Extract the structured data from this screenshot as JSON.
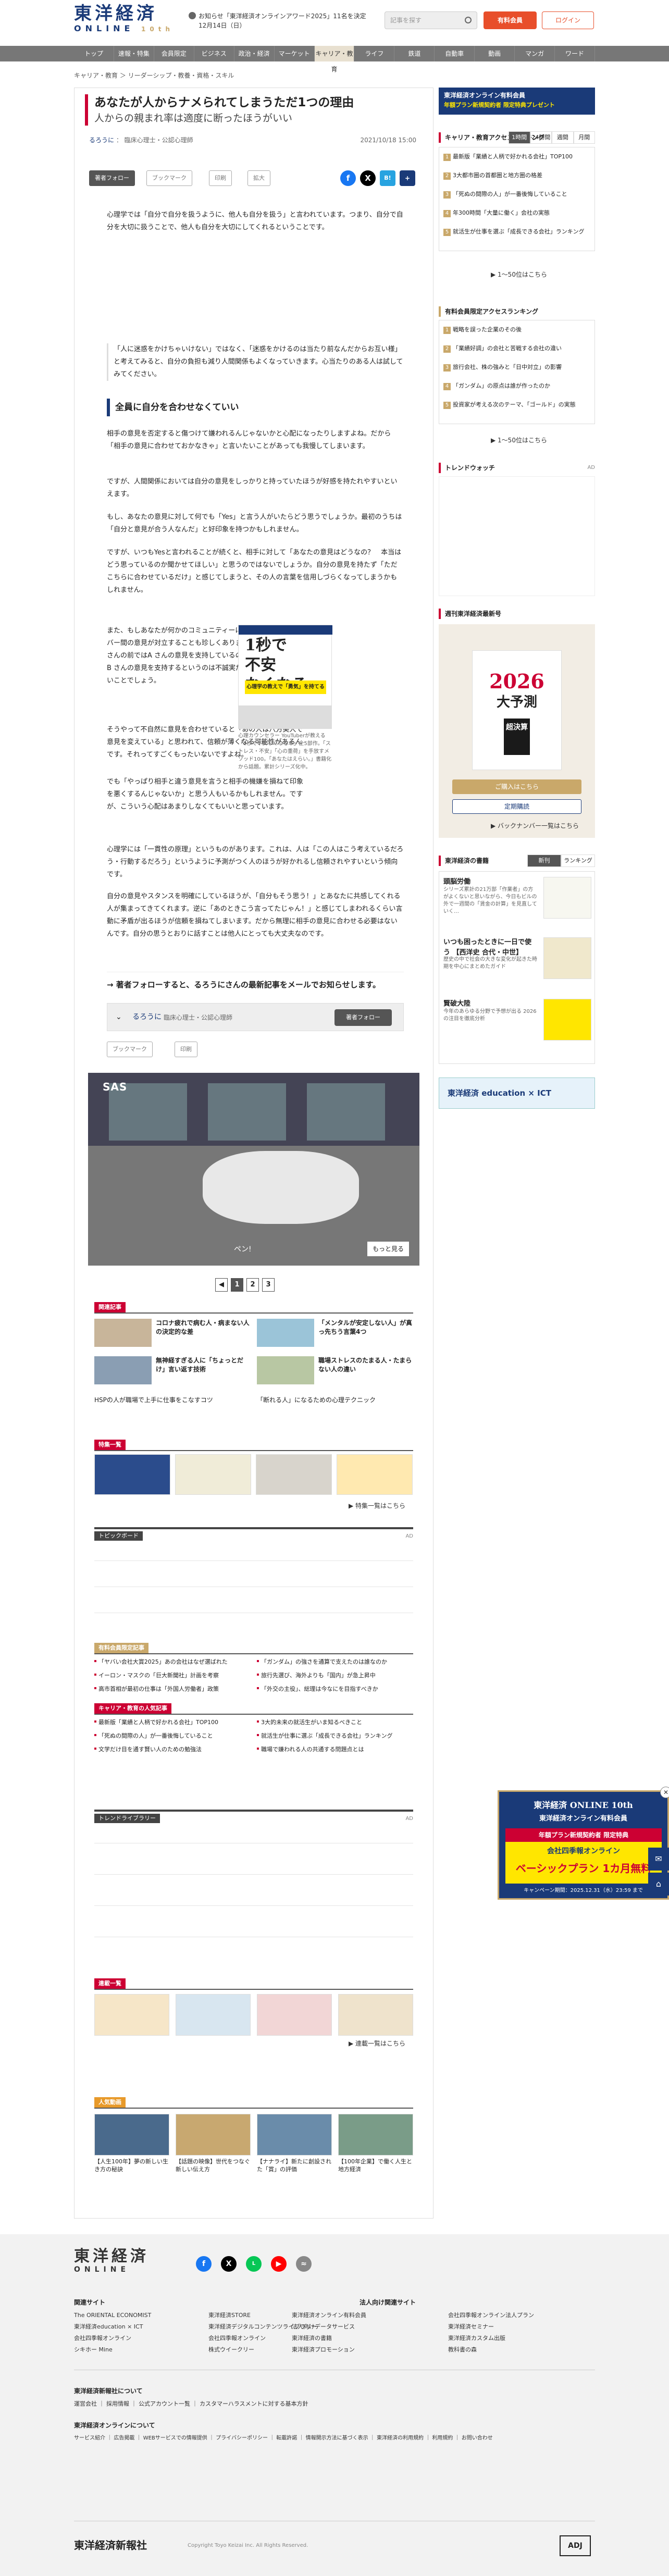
{
  "header": {
    "logo_top": "東洋経済",
    "logo_bottom": "ONLINE",
    "logo_badge": "10th",
    "notice_line1": "お知らせ「東洋経済オンラインアワード2025」11名を決定",
    "notice_line2": "12月14日（日）",
    "search_placeholder": "記事を探す",
    "member_button": "有料会員",
    "login_button": "ログイン"
  },
  "nav": [
    "トップ",
    "速報・特集",
    "会員限定",
    "ビジネス",
    "政治・経済",
    "マーケット",
    "キャリア・教育",
    "ライフ",
    "鉄道",
    "自動車",
    "動画",
    "マンガ",
    "ワード"
  ],
  "breadcrumb": "キャリア・教育 ＞ リーダーシップ・教養・資格・スキル",
  "article": {
    "title": "あなたが人からナメられてしまうただ1つの理由",
    "subtitle": "人からの親まれ率は適度に断ったほうがいい",
    "author_name": "るろうに",
    "author_role": "臨床心理士・公認心理師",
    "date": "2021/10/18 15:00",
    "follow_btn": "著者フォロー",
    "bookmark_btn": "ブックマーク",
    "print_btn": "印刷",
    "font_btn": "拡大",
    "p1": "心理学では「自分で自分を扱うように、他人も自分を扱う」と言われています。つまり、自分で自分を大切に扱うことで、他人も自分を大切にしてくれるということです。",
    "p2": "「人に迷惑をかけちゃいけない」ではなく、「迷惑をかけるのは当たり前なんだからお互い様」と考えてみると、自分の負担も減り人間関係もよくなっていきます。心当たりのある人は試してみてください。",
    "h2": "全員に自分を合わせなくていい",
    "p3": "相手の意見を否定すると傷つけて嫌われるんじゃないかと心配になったりしますよね。だから「相手の意見に合わせておかなきゃ」と言いたいことがあっても我慢してしまいます。",
    "p4": "ですが、人間関係においては自分の意見をしっかりと持っていたほうが好感を持たれやすいといえます。",
    "p5": "もし、あなたの意見に対して何でも「Yes」と言う人がいたらどう思うでしょうか。最初のうちは「自分と意見が合う人なんだ」と好印象を持つかもしれません。",
    "p6": "ですが、いつもYesと言われることが続くと、相手に対して「あなたの意見はどうなの？　本当はどう思っているのか聞かせてほしい」と思うのではないでしょうか。自分の意見を持たず「ただこちらに合わせているだけ」と感じてしまうと、その人の言葉を信用しづらくなってしまうかもしれません。",
    "p7": "また、もしあなたが何かのコミュニティーに属していれば、メンバー間の意見が対立することも珍しくありません。そのとき、A さんの前ではA さんの意見を支持しているのに、B さんの前ではB さんの意見を支持するというのは不誠実だと思われても仕方ないことでしょう。",
    "p8": "そうやって不自然に意見を合わせていると「あの人は八方美人で意見を変えている」と思われて、信頼が薄くなる可能性があるんです。それってすごくもったいないですよね。",
    "p9": "でも「やっぱり相手と違う意見を言うと相手の機嫌を損ねて印象を悪くするんじゃないか」と思う人もいるかもしれません。ですが、こういう心配はあまりしなくてもいいと思っています。",
    "p10": "心理学には「一貫性の原理」というものがあります。これは、人は「この人はこう考えているだろう・行動するだろう」というように予測がつく人のほうが好かれるし信頼されやすいという傾向です。",
    "p11": "自分の意見やスタンスを明確にしているほうが、「自分もそう思う！」とあなたに共感してくれる人が集まってきてくれます。逆に「あのときこう言ってたじゃん！」と感じてしまわれるくらい言動に矛盾が出るほうが信頼を損ねてしまいます。だから無理に相手の意見に合わせる必要はないんです。自分の思うとおりに話すことは他人にとっても大丈夫なのです。",
    "follow_strip": "→ 著者フォローすると、るろうにさんの最新記事をメールでお知らせします。"
  },
  "book_ad": {
    "big_line1": "1秒で",
    "big_line2": "不安",
    "big_line3": "なくなる",
    "tag": "心理学の教えで「勇気」を持てる",
    "caption": "心理カウンセラー YouTuberが教える「1秒で不安なくなる本」全5部作。「ストレス・不安」「心の重荷」を手放すメソッド100。「あなたはえらい。」書籍化から話題。累計シリーズ化中。"
  },
  "video": {
    "logo": "SAS",
    "caption": "ペン!",
    "more": "もっと見る"
  },
  "pager": [
    "1",
    "2",
    "3"
  ],
  "related": {
    "label": "関連記事",
    "items": [
      "コロナ疲れで病む人・病まない人の決定的な差",
      "「メンタルが安定しない人」が真っ先ちう言葉4つ",
      "無神経すぎる人に「ちょっとだけ」言い返す技術",
      "職場ストレスのたまる人・たまらない人の違い",
      "HSPの人が職場で上手に仕事をこなすコツ",
      "「断れる人」になるための心理テクニック"
    ]
  },
  "features": {
    "label": "特集一覧",
    "more": "▶ 特集一覧はこちら"
  },
  "topic_board": {
    "label": "トピックボード",
    "ad": "AD"
  },
  "paid_news": {
    "label": "有料会員限定記事",
    "items": [
      "「ヤバい会社大賞2025」あの会社はなぜ選ばれた",
      "「ガンダム」の強さを通算で支えたのは誰なのか",
      "イーロン・マスクの「巨大新聞社」計画を考察",
      "旅行先選び、海外よりも「国内」が急上昇中",
      "高市首相が最初の仕事は「外国人労働者」政策",
      "「外交の主役」、総理は今なにを目指すべきか"
    ]
  },
  "career_news": {
    "label": "キャリア・教育の人気記事",
    "items": [
      "最新版「業績と人柄で好かれる会社」TOP100",
      "3大的未来の就活生がいま知るべきこと",
      "「死ぬの間際の人」が一番後悔していること",
      "就活生が仕事に選ぶ「成長できる会社」ランキング",
      "文学だけ目を通す賢い人のための勉強法",
      "職場で嫌われる人の共通する問題点とは"
    ]
  },
  "trend_library": {
    "label": "トレンドライブラリー",
    "ad": "AD"
  },
  "serial": {
    "label": "連載一覧",
    "more": "▶ 連載一覧はこちら"
  },
  "popular_video": {
    "label": "人気動画",
    "items": [
      "【人生100年】夢の新しい生き方の秘訣",
      "【話題の映像】世代をつなぐ新しい伝え方",
      "【ナナライ】新たに創設された「賞」の評価",
      "【100年企業】で働く人生と地方経済"
    ]
  },
  "sidebar": {
    "ad_top_title": "東洋経済オンライン有料会員",
    "ad_top_sub": "年額プラン新規契約者 限定特典プレゼント",
    "career_rank_title": "キャリア・教育アクセスランキング",
    "rank_tabs": [
      "1時間",
      "24時間",
      "週間",
      "月間"
    ],
    "career_rank": [
      "最新版「業績と人柄で好かれる会社」TOP100",
      "3大都市圏の首都圏と地方圏の格差",
      "「死ぬの間際の人」が一番後悔していること",
      "年300時間「大量に働く」会社の実態",
      "就活生が仕事を選ぶ「成長できる会社」ランキング"
    ],
    "rank_more": "▶ 1〜50位はこちら",
    "paid_rank_title": "有料会員限定アクセスランキング",
    "paid_rank": [
      "戦略を誤った企業のその後",
      "「業績好調」の会社と苦戦する会社の違い",
      "旅行会社、株の強みと「日中対立」の影響",
      "「ガンダム」の原点は誰が作ったのか",
      "投資家が考える次のテーマ、「ゴールド」の実態"
    ],
    "trend_title": "トレンドウォッチ",
    "ad_label": "AD",
    "zasshi_title": "週刊東洋経済最新号",
    "zasshi_year": "2026",
    "zasshi_word": "大予測",
    "zasshi_box": "超決算",
    "zasshi_btn1": "ご購入はこちら",
    "zasshi_btn2": "定期購読",
    "zasshi_more": "▶ バックナンバー一覧はこちら",
    "pub_title": "東洋経済の書籍",
    "pub_tabs": [
      "新刊",
      "ランキング"
    ],
    "pub_items": [
      {
        "t": "頭脳労働",
        "d": "シリーズ累計の21万部「作業者」の方がよくないと思いながら、今日もビルの外で一週間の「賃金の計算」を見直していく…"
      },
      {
        "t": "いつも困ったときに一日で使う 【西洋史 合代・中世】",
        "d": "歴史の中で社会の大きな変化が起きた時期を中心にまとめたガイド"
      },
      {
        "t": "賢破大陸",
        "d": "今年のあらゆる分野で予想が出る 2026 の注目を徹底分析"
      }
    ],
    "edu_banner": "東洋経済 education × ICT"
  },
  "float_ad": {
    "top": "東洋経済 ONLINE 10th",
    "line1": "東洋経済オンライン有料会員",
    "line2": "年額プラン新規契約者 限定特典",
    "line3": "会社四季報オンライン",
    "line4": "ベーシックプラン 1カ月無料",
    "line5": "キャンペーン期間：2025.12.31（水）23:59 まで"
  },
  "footer": {
    "logo_top": "東洋経済",
    "logo_bottom": "ONLINE",
    "related_title": "関連サイト",
    "col1": [
      "The ORIENTAL ECONOMIST",
      "東洋経済education × ICT",
      "会社四季報オンライン",
      "シキホー Mine"
    ],
    "col2": [
      "東洋経済STORE",
      "東洋経済デジタルコンテンツライブラリー",
      "会社四季報オンライン",
      "株式ウイークリー"
    ],
    "col3": [
      "東洋経済オンライン有料会員",
      "法人向けデータサービス",
      "東洋経済の書籍",
      "東洋経済プロモーション"
    ],
    "corp_title": "法人向け関連サイト",
    "col4": [
      "会社四季報オンライン法人プラン",
      "東洋経済セミナー",
      "東洋経済カスタム出版",
      "教科書の森"
    ],
    "about_title": "東洋経済新報社について",
    "about_links": "運営会社 ｜ 採用情報 ｜ 公式アカウント一覧 ｜ カスタマーハラスメントに対する基本方針",
    "online_title": "東洋経済オンラインについて",
    "online_links": "サービス紹介 ｜ 広告掲載 ｜ WEBサービスでの情報提供 ｜ プライバシーポリシー ｜ 転載許諾 ｜ 情報開示方法に基づく表示 ｜ 東洋経済の利用規約 ｜ 利用規約 ｜ お問い合わせ",
    "corp_name": "東洋経済新報社",
    "copyright": "Copyright Toyo Keizai Inc. All Rights Reserved.",
    "adj": "ADJ"
  }
}
